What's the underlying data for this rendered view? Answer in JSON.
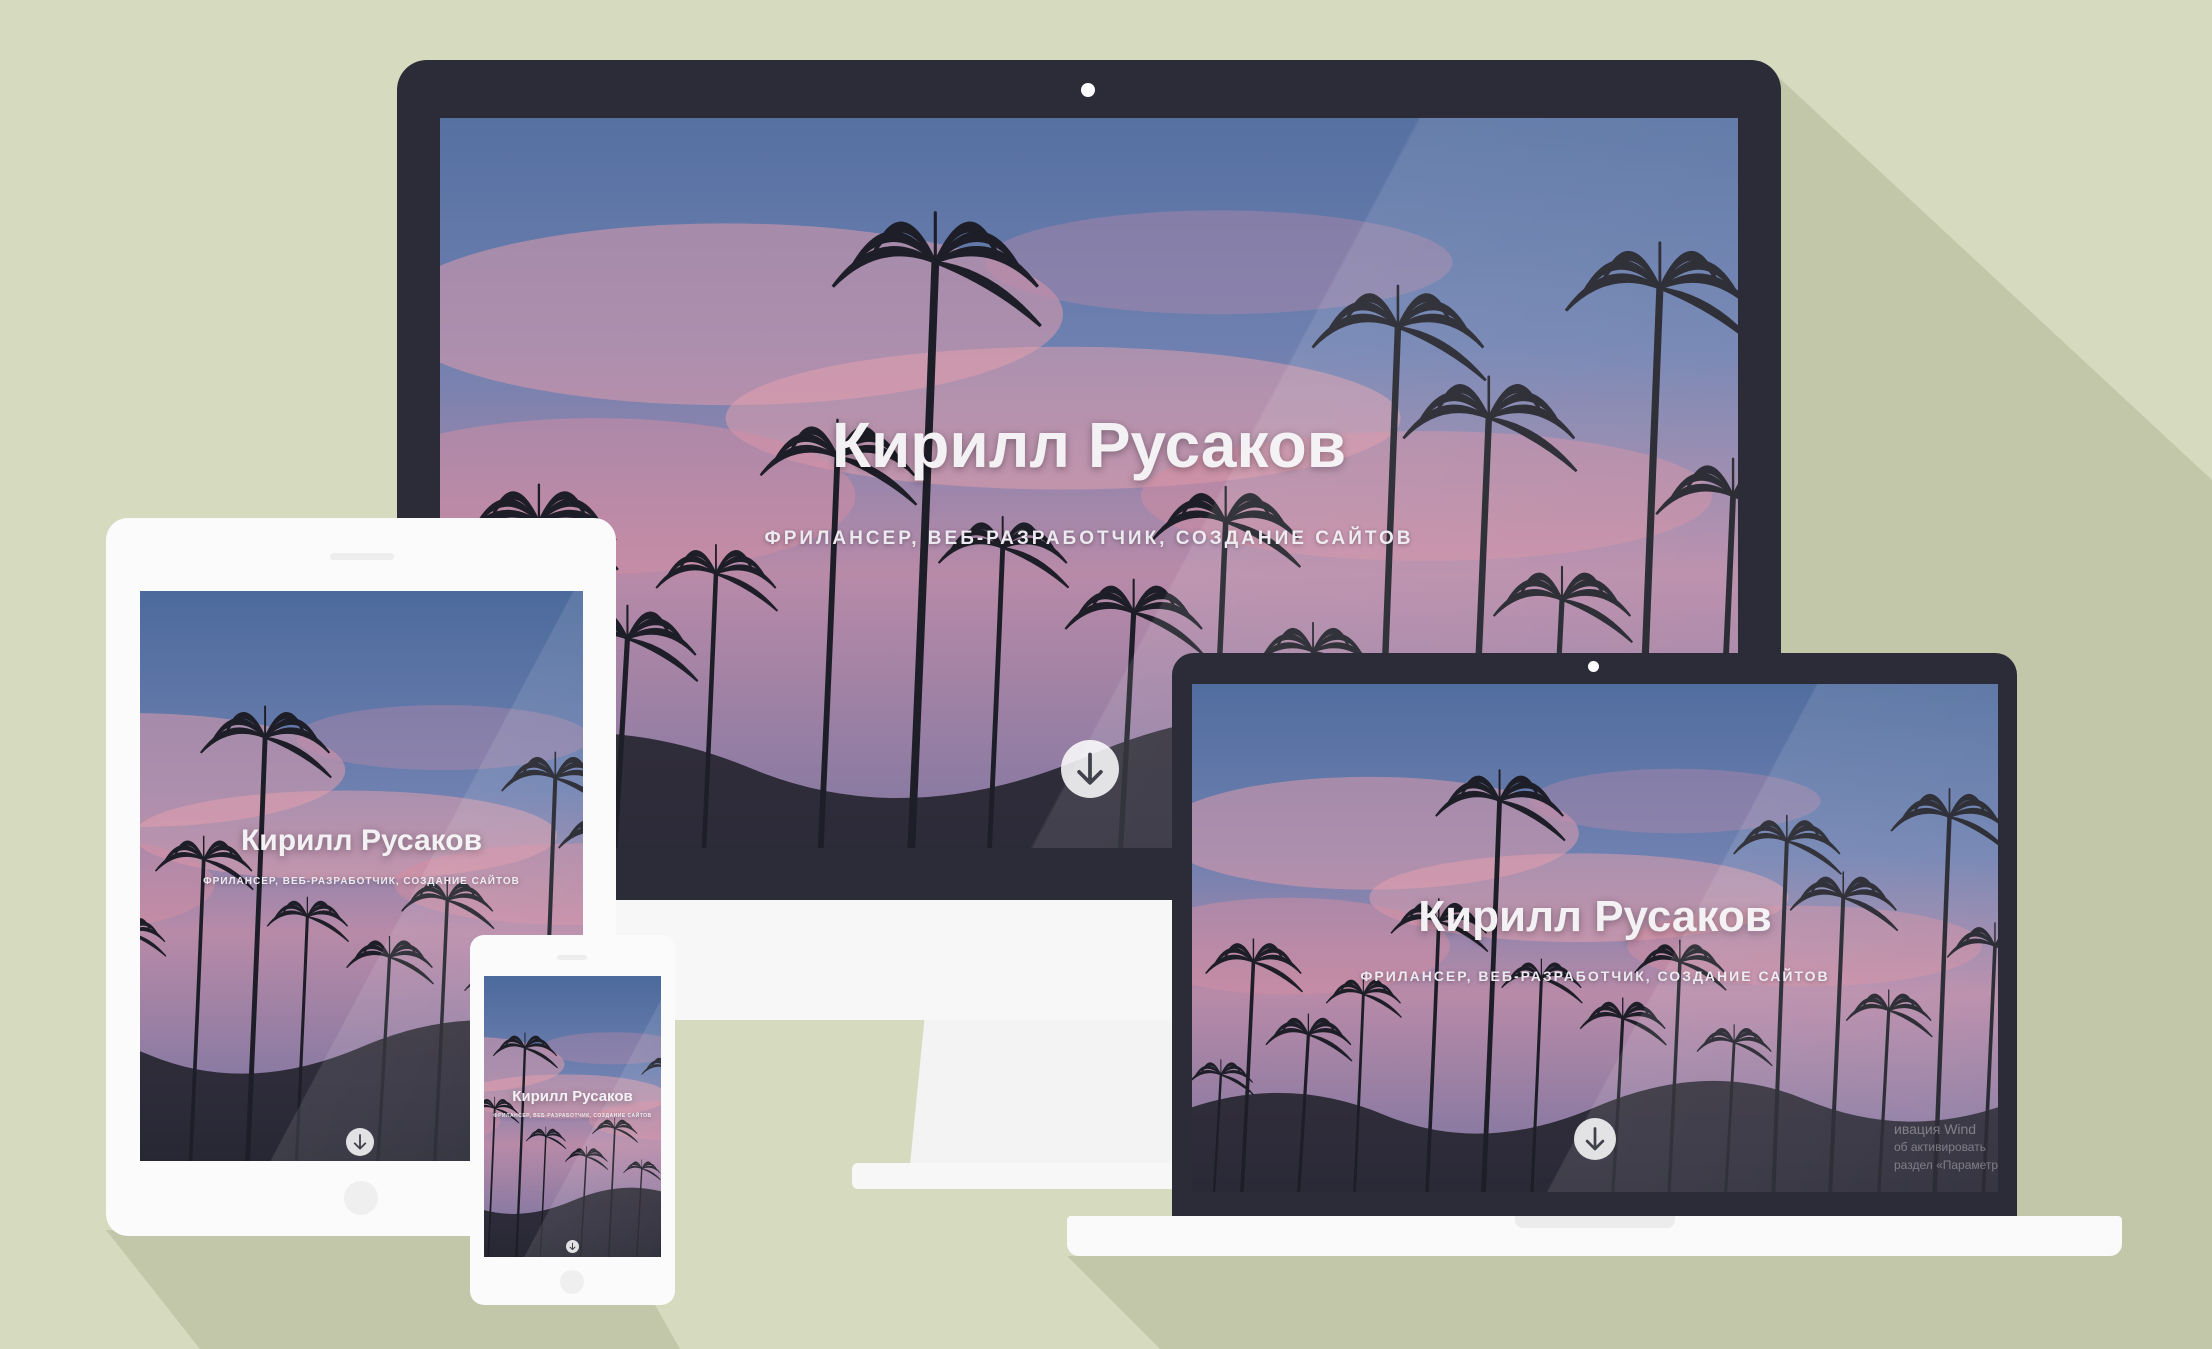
{
  "hero": {
    "name": "Кирилл Русаков",
    "tagline": "ФРИЛАНСЕР, ВЕБ-РАЗРАБОТЧИК, СОЗДАНИЕ САЙТОВ"
  },
  "os_watermark": {
    "line1": "ивация Wind",
    "line2": "об активировать",
    "line3": "раздел «Параметры»"
  },
  "icons": {
    "scroll_down": "arrow-down-circle-icon",
    "camera": "camera-dot-icon"
  },
  "colors": {
    "background": "#d6dbbf",
    "shadow": "#c2c7aa",
    "device_dark": "#2c2c38",
    "device_light": "#f7f7f7",
    "sky_top": "#4c6a9c",
    "sky_pink": "#d98ea0",
    "palm_silhouette": "#1e1e28"
  }
}
